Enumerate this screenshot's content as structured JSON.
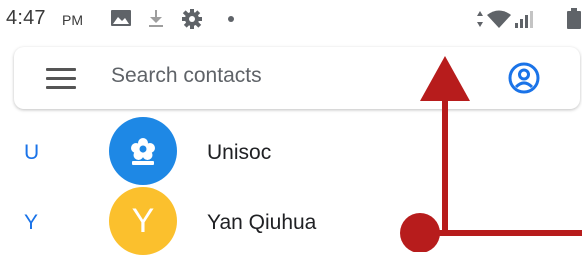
{
  "status_bar": {
    "time": "4:47",
    "ampm": "PM",
    "icons": [
      "image-icon",
      "download-icon",
      "gear-icon",
      "dot-icon",
      "vibrate-icon",
      "wifi-icon",
      "signal-icon",
      "battery-icon"
    ]
  },
  "search": {
    "placeholder": "Search contacts",
    "menu_icon": "menu-icon",
    "account_icon": "account-circle-icon"
  },
  "contacts": [
    {
      "letter": "U",
      "name": "Unisoc",
      "avatar_type": "icon",
      "avatar_color": "#1e88e5"
    },
    {
      "letter": "Y",
      "name": "Yan Qiuhua",
      "avatar_type": "letter",
      "avatar_letter": "Y",
      "avatar_color": "#fbc02d"
    }
  ],
  "colors": {
    "accent": "#1a73e8",
    "annotation": "#b71c1c"
  }
}
